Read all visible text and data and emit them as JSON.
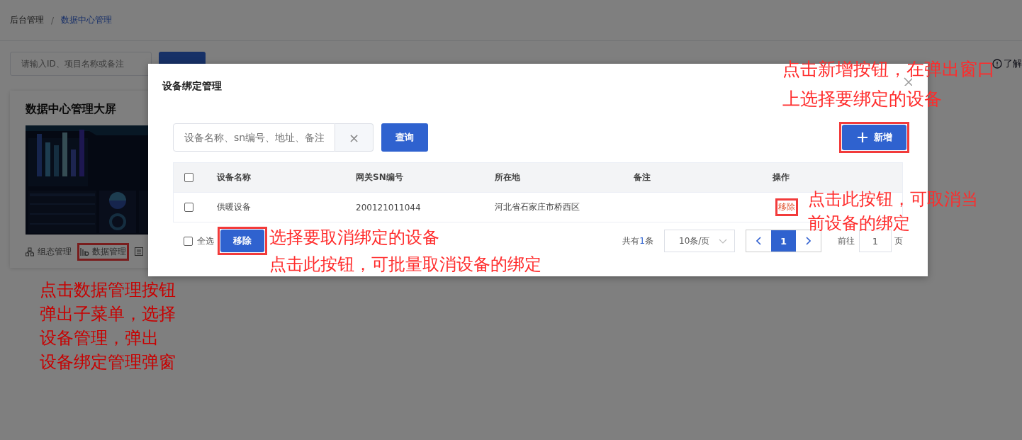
{
  "breadcrumb": [
    {
      "label": "后台管理",
      "current": false
    },
    {
      "label": "数据中心管理",
      "current": true
    }
  ],
  "breadcrumb_separator": "/",
  "search": {
    "placeholder": "请输入ID、项目名称或备注"
  },
  "help_link": "了解",
  "card": {
    "title": "数据中心管理大屏",
    "actions": [
      {
        "kind": "hierarchy",
        "label": "组态管理",
        "highlighted": false
      },
      {
        "kind": "bars",
        "label": "数据管理",
        "highlighted": true
      },
      {
        "kind": "list",
        "highlighted": false
      }
    ]
  },
  "dialog": {
    "title": "设备绑定管理",
    "search": {
      "placeholder": "设备名称、sn编号、地址、备注",
      "clear": "×",
      "button": "查询"
    },
    "add_button": {
      "label": "新增",
      "highlighted": true
    },
    "table": {
      "select_all_header_checked": false,
      "columns": [
        "设备名称",
        "网关SN编号",
        "所在地",
        "备注",
        "操作"
      ],
      "rows": [
        {
          "checked": false,
          "name": "供暖设备",
          "sn": "200121011044",
          "location": "河北省石家庄市桥西区",
          "action": {
            "label": "移除",
            "highlighted": true
          }
        }
      ]
    },
    "footer": {
      "select_all": {
        "label": "全选",
        "checked": false
      },
      "batch_remove": {
        "label": "移除",
        "highlighted": true
      },
      "total_prefix": "共有",
      "total": "1",
      "total_suffix": "条",
      "page_size": "10条/页",
      "pages": [
        {
          "label": "1",
          "selected": true
        }
      ],
      "jump_prefix": "前往",
      "jump_value": "1",
      "jump_suffix": "页"
    }
  },
  "annotations": [
    {
      "kind": "add",
      "lines": [
        "点击新增按钮，在弹出窗口",
        "上选择要绑定的设备"
      ]
    },
    {
      "kind": "row-remove",
      "lines": [
        "点击此按钮，可取消当",
        "前设备的绑定"
      ]
    },
    {
      "kind": "batch-remove",
      "lines": [
        "选择要取消绑定的设备",
        "点击此按钮，可批量取消设备的绑定"
      ]
    },
    {
      "kind": "data-manage",
      "lines": [
        "点击数据管理按钮",
        "弹出子菜单，选择",
        "设备管理，弹出",
        "设备绑定管理弹窗"
      ]
    }
  ]
}
